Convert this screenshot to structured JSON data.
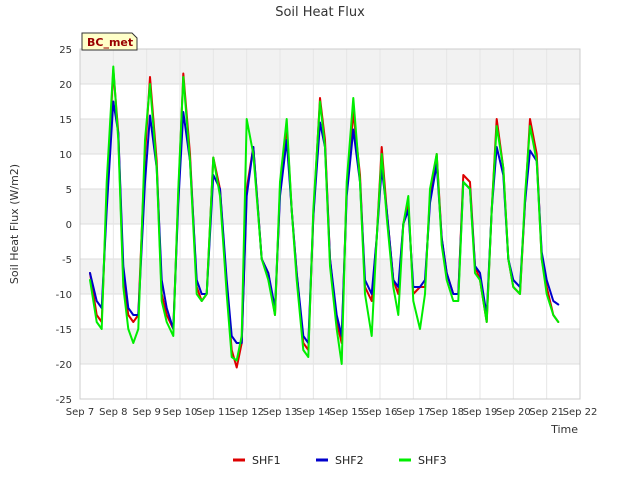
{
  "chart_data": {
    "type": "line",
    "title": "Soil Heat Flux",
    "xlabel": "Time",
    "ylabel": "Soil Heat Flux (W/m2)",
    "badge": "BC_met",
    "xlim": [
      7,
      22
    ],
    "ylim": [
      -25,
      25
    ],
    "x_ticks": [
      7,
      8,
      9,
      10,
      11,
      12,
      13,
      14,
      15,
      16,
      17,
      18,
      19,
      20,
      21,
      22
    ],
    "x_tick_labels": [
      "Sep 7",
      "Sep 8",
      "Sep 9",
      "Sep 10",
      "Sep 11",
      "Sep 12",
      "Sep 13",
      "Sep 14",
      "Sep 15",
      "Sep 16",
      "Sep 17",
      "Sep 18",
      "Sep 19",
      "Sep 20",
      "Sep 21",
      "Sep 22"
    ],
    "y_ticks": [
      -25,
      -20,
      -15,
      -10,
      -5,
      0,
      5,
      10,
      15,
      20,
      25
    ],
    "y_tick_labels": [
      "-25",
      "-20",
      "-15",
      "-10",
      "-5",
      "0",
      "5",
      "10",
      "15",
      "20",
      "25"
    ],
    "grid": true,
    "legend_position": "bottom",
    "series": [
      {
        "name": "SHF1",
        "color": "#dd0000",
        "x": [
          7.3,
          7.5,
          7.65,
          7.8,
          8.0,
          8.15,
          8.3,
          8.45,
          8.6,
          8.75,
          8.95,
          9.1,
          9.3,
          9.45,
          9.6,
          9.8,
          9.95,
          10.1,
          10.3,
          10.5,
          10.65,
          10.8,
          11.0,
          11.2,
          11.4,
          11.55,
          11.7,
          11.85,
          12.0,
          12.2,
          12.45,
          12.65,
          12.85,
          13.0,
          13.2,
          13.35,
          13.5,
          13.7,
          13.85,
          14.0,
          14.2,
          14.35,
          14.5,
          14.7,
          14.85,
          15.0,
          15.2,
          15.4,
          15.55,
          15.75,
          15.9,
          16.05,
          16.2,
          16.4,
          16.55,
          16.7,
          16.85,
          17.0,
          17.2,
          17.35,
          17.5,
          17.7,
          17.85,
          18.0,
          18.2,
          18.35,
          18.5,
          18.7,
          18.85,
          19.0,
          19.2,
          19.35,
          19.5,
          19.7,
          19.85,
          20.0,
          20.2,
          20.35,
          20.5,
          20.7,
          20.85,
          21.0,
          21.2,
          21.35
        ],
        "y": [
          -7,
          -13,
          -14,
          4,
          22,
          13,
          -8,
          -13,
          -14,
          -13,
          10,
          21,
          9,
          -10,
          -13,
          -15,
          4,
          21.5,
          10,
          -9,
          -11,
          -10,
          9.5,
          5,
          -9,
          -18,
          -20.5,
          -17,
          5,
          11,
          -5,
          -7,
          -13,
          5,
          14,
          2,
          -7,
          -17,
          -18,
          1,
          18,
          12,
          -5,
          -14,
          -17,
          5,
          16,
          7,
          -9,
          -11,
          -2,
          11,
          2,
          -8,
          -10,
          0,
          3,
          -10,
          -9,
          -9,
          4,
          10,
          -2,
          -7,
          -10,
          -10,
          7,
          6,
          -6,
          -8,
          -14,
          2,
          15,
          8,
          -5,
          -9,
          -10,
          3,
          15,
          10,
          -5,
          -9,
          -13,
          -14
        ]
      },
      {
        "name": "SHF2",
        "color": "#0000cc",
        "x": [
          7.3,
          7.5,
          7.65,
          7.8,
          8.0,
          8.15,
          8.3,
          8.45,
          8.6,
          8.75,
          8.95,
          9.1,
          9.3,
          9.45,
          9.6,
          9.8,
          9.95,
          10.1,
          10.3,
          10.5,
          10.65,
          10.8,
          11.0,
          11.2,
          11.4,
          11.55,
          11.7,
          11.85,
          12.0,
          12.2,
          12.45,
          12.65,
          12.85,
          13.0,
          13.2,
          13.35,
          13.5,
          13.7,
          13.85,
          14.0,
          14.2,
          14.35,
          14.5,
          14.7,
          14.85,
          15.0,
          15.2,
          15.4,
          15.55,
          15.75,
          15.9,
          16.05,
          16.2,
          16.4,
          16.55,
          16.7,
          16.85,
          17.0,
          17.2,
          17.35,
          17.5,
          17.7,
          17.85,
          18.0,
          18.2,
          18.35,
          18.5,
          18.7,
          18.85,
          19.0,
          19.2,
          19.35,
          19.5,
          19.7,
          19.85,
          20.0,
          20.2,
          20.35,
          20.5,
          20.7,
          20.85,
          21.0,
          21.2,
          21.35
        ],
        "y": [
          -7,
          -11,
          -12,
          2,
          17.5,
          13,
          -6,
          -12,
          -13,
          -13,
          6,
          15.5,
          8,
          -8,
          -12,
          -15,
          3,
          16,
          9,
          -8,
          -10,
          -10,
          7,
          5,
          -8,
          -16,
          -17,
          -17,
          4,
          11,
          -5,
          -7,
          -12,
          4,
          12,
          2,
          -7,
          -16,
          -17,
          1,
          14.5,
          11,
          -5,
          -13,
          -16,
          4,
          13.5,
          6,
          -8,
          -10,
          -2,
          8,
          2,
          -8,
          -9,
          0,
          2,
          -9,
          -9,
          -8,
          3,
          8.5,
          -2,
          -7,
          -10,
          -10,
          6,
          5,
          -6,
          -7,
          -13,
          2,
          11,
          7,
          -5,
          -8,
          -9,
          3,
          10.5,
          9,
          -4,
          -8,
          -11,
          -11.5
        ]
      },
      {
        "name": "SHF3",
        "color": "#00ee00",
        "x": [
          7.3,
          7.5,
          7.65,
          7.8,
          8.0,
          8.15,
          8.3,
          8.45,
          8.6,
          8.75,
          8.95,
          9.1,
          9.3,
          9.45,
          9.6,
          9.8,
          9.95,
          10.1,
          10.3,
          10.5,
          10.65,
          10.8,
          11.0,
          11.2,
          11.4,
          11.55,
          11.7,
          11.85,
          12.0,
          12.2,
          12.45,
          12.65,
          12.85,
          13.0,
          13.2,
          13.35,
          13.5,
          13.7,
          13.85,
          14.0,
          14.2,
          14.35,
          14.5,
          14.7,
          14.85,
          15.0,
          15.2,
          15.4,
          15.55,
          15.75,
          15.9,
          16.05,
          16.2,
          16.4,
          16.55,
          16.7,
          16.85,
          17.0,
          17.2,
          17.35,
          17.5,
          17.7,
          17.85,
          18.0,
          18.2,
          18.35,
          18.5,
          18.7,
          18.85,
          19.0,
          19.2,
          19.35,
          19.5,
          19.7,
          19.85,
          20.0,
          20.2,
          20.35,
          20.5,
          20.7,
          20.85,
          21.0,
          21.2,
          21.35
        ],
        "y": [
          -8,
          -14,
          -15,
          6,
          22.5,
          12,
          -9,
          -15,
          -17,
          -15,
          12,
          20,
          8,
          -11,
          -14,
          -16,
          5,
          21,
          9,
          -10,
          -11,
          -10,
          9.5,
          4,
          -10,
          -19,
          -19.5,
          -16,
          15,
          10,
          -5,
          -8,
          -13,
          6,
          15,
          2,
          -8,
          -18,
          -19,
          2,
          17.5,
          11,
          -6,
          -15,
          -20,
          6,
          18,
          6,
          -10,
          -16,
          -2,
          10,
          1,
          -9,
          -13,
          0,
          4,
          -11,
          -15,
          -10,
          5,
          10,
          -3,
          -8,
          -11,
          -11,
          6,
          5,
          -7,
          -8,
          -14,
          2,
          14,
          8,
          -5,
          -9,
          -10,
          4,
          14,
          9,
          -5,
          -10,
          -13,
          -14
        ]
      }
    ]
  }
}
